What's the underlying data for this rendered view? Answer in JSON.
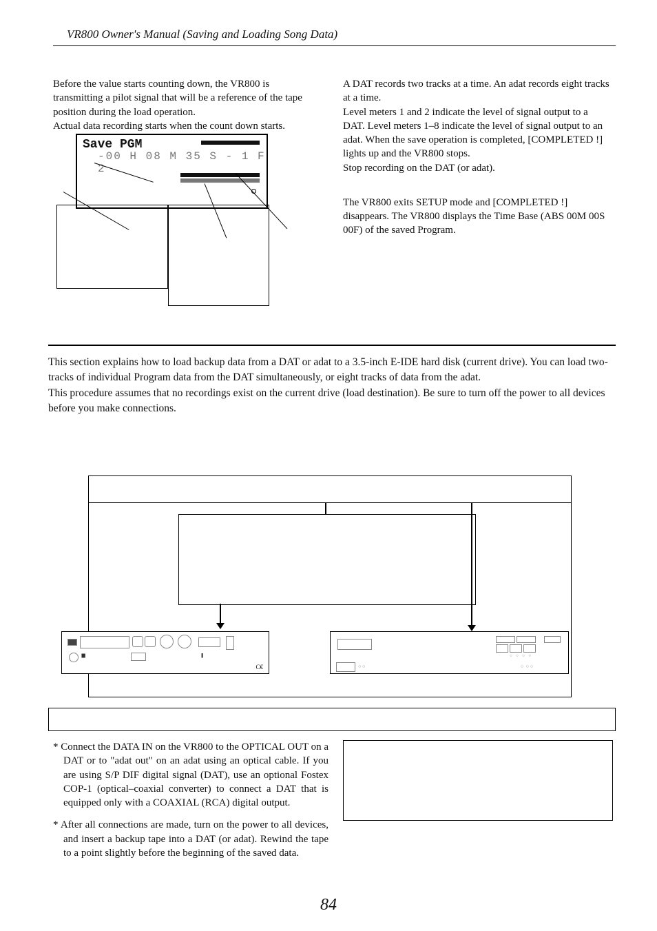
{
  "header": "VR800 Owner's Manual (Saving and Loading Song Data)",
  "leftCol": {
    "p1": "Before the value starts counting down, the VR800 is transmitting a pilot signal that will be a reference of the tape position during the load operation.",
    "p2": "Actual data recording starts when the count down starts."
  },
  "lcd": {
    "title": "Save PGM",
    "digits": "-00 H 08 M 35 S - 1 F 2"
  },
  "rightCol": {
    "p1": "A DAT records two tracks at a time.  An adat records eight tracks at a time.",
    "p2": "Level meters 1 and 2 indicate the level of signal output to a DAT.  Level meters 1–8 indicate the level of signal output to an adat. When the save operation is completed, [COMPLETED !] lights up and the VR800 stops.",
    "p3": "Stop recording on the DAT (or adat).",
    "p4": "The VR800 exits SETUP mode and [COMPLETED !] disappears.  The VR800 displays the Time Base (ABS 00M 00S 00F) of the saved Program."
  },
  "intro": {
    "p1": "This section explains how to load backup data from a DAT or adat to a 3.5-inch E-IDE hard disk (current drive). You can load two-tracks of individual Program data from the DAT simultaneously, or eight tracks of data from the adat.",
    "p2": "This procedure assumes that no recordings exist on the current drive (load destination).  Be sure to turn off the power to all devices before you make connections."
  },
  "bullets": {
    "b1": "* Connect the DATA IN on the VR800 to the OPTICAL OUT on a DAT or to \"adat out\" on an adat using an optical cable.  If you are using S/P DIF digital signal (DAT), use an optional Fostex COP-1 (optical–coaxial converter) to connect a DAT that is equipped only with a COAXIAL (RCA) digital output.",
    "b2": "* After all connections are made, turn on the power to all devices, and insert a backup tape into a DAT (or adat).  Rewind the tape to a point slightly before the beginning of the saved data."
  },
  "pageNumber": "84"
}
